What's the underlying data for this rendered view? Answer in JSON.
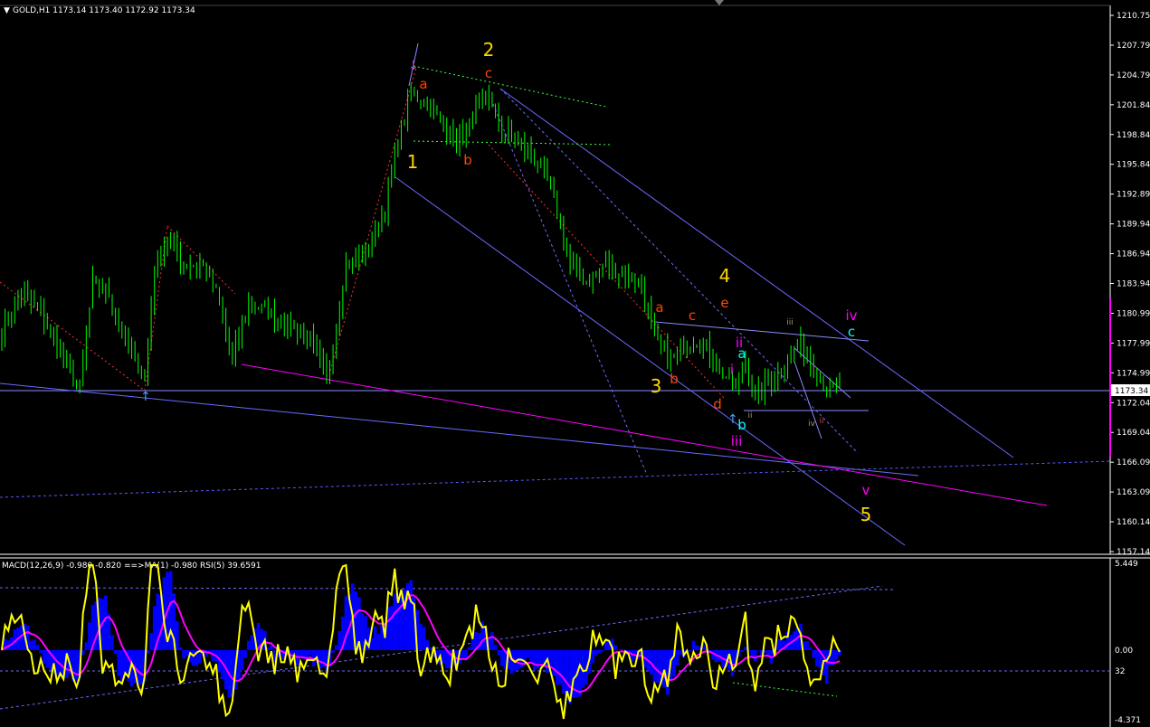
{
  "main_header": "GOLD,H1  1173.14 1173.40 1172.92 1173.34",
  "sub_header": "MACD(12,26,9) -0.980 -0.820  ==>MA(1) -0.980  RSI(5) 39.6591",
  "price_scale": [
    "1210.75",
    "1207.79",
    "1204.79",
    "1201.84",
    "1198.84",
    "1195.84",
    "1192.89",
    "1189.94",
    "1186.94",
    "1183.94",
    "1180.99",
    "1177.99",
    "1174.99",
    "1172.04",
    "1169.04",
    "1166.09",
    "1163.09",
    "1160.14",
    "1157.14"
  ],
  "current_price": "1173.34",
  "osc_scale": [
    "5.449",
    "0.00",
    "32",
    "-4.371"
  ],
  "colors": {
    "bg": "#000000",
    "candle": "#00ff00",
    "grid_line": "#6a6aff",
    "magenta": "#ff00ff",
    "yellow": "#ffff00",
    "pink": "#ff00ff",
    "hist": "#0000ff",
    "wave_main": "#ffd700",
    "wave_sub": "#ff4500",
    "wave_cyan": "#00ffff",
    "wave_mag": "#ff00ff"
  },
  "wave_labels": [
    {
      "text": "1",
      "color": "#ffd700",
      "size": "main"
    },
    {
      "text": "2",
      "color": "#ffd700",
      "size": "main"
    },
    {
      "text": "3",
      "color": "#ffd700",
      "size": "main"
    },
    {
      "text": "4",
      "color": "#ffd700",
      "size": "main"
    },
    {
      "text": "5",
      "color": "#ffd700",
      "size": "main"
    },
    {
      "text": "a",
      "color": "#ff4500",
      "size": "sub"
    },
    {
      "text": "b",
      "color": "#ff4500",
      "size": "sub"
    },
    {
      "text": "c",
      "color": "#ff4500",
      "size": "sub"
    },
    {
      "text": "a",
      "color": "#ff4500",
      "size": "sub"
    },
    {
      "text": "b",
      "color": "#ff4500",
      "size": "sub"
    },
    {
      "text": "c",
      "color": "#ff4500",
      "size": "sub"
    },
    {
      "text": "d",
      "color": "#ff4500",
      "size": "sub"
    },
    {
      "text": "e",
      "color": "#ff4500",
      "size": "sub"
    },
    {
      "text": "i",
      "color": "#ff00ff",
      "size": "sub"
    },
    {
      "text": "ii",
      "color": "#ff00ff",
      "size": "sub"
    },
    {
      "text": "iii",
      "color": "#ff00ff",
      "size": "sub"
    },
    {
      "text": "iv",
      "color": "#ff00ff",
      "size": "sub"
    },
    {
      "text": "v",
      "color": "#ff00ff",
      "size": "sub"
    },
    {
      "text": "a",
      "color": "#00ffff",
      "size": "sub"
    },
    {
      "text": "b",
      "color": "#00ffff",
      "size": "sub"
    },
    {
      "text": "c",
      "color": "#00ffff",
      "size": "sub"
    },
    {
      "text": "iii",
      "color": "#9a9a6a",
      "size": "tiny"
    },
    {
      "text": "ii",
      "color": "#9a9a6a",
      "size": "tiny"
    },
    {
      "text": "iv",
      "color": "#9a9a6a",
      "size": "tiny"
    },
    {
      "text": "i",
      "color": "#cc4444",
      "size": "tiny"
    },
    {
      "text": "ii",
      "color": "#cc4444",
      "size": "tiny"
    }
  ],
  "chart_data": {
    "type": "candlestick",
    "symbol": "GOLD",
    "timeframe": "H1",
    "ylim": [
      1156.0,
      1212.0
    ],
    "close_path": [
      {
        "bar": 0,
        "price": 1179.0
      },
      {
        "bar": 6,
        "price": 1183.0
      },
      {
        "bar": 12,
        "price": 1181.0
      },
      {
        "bar": 18,
        "price": 1177.0
      },
      {
        "bar": 24,
        "price": 1173.0
      },
      {
        "bar": 28,
        "price": 1184.0
      },
      {
        "bar": 33,
        "price": 1183.0
      },
      {
        "bar": 38,
        "price": 1178.0
      },
      {
        "bar": 44,
        "price": 1174.0
      },
      {
        "bar": 47,
        "price": 1186.0
      },
      {
        "bar": 51,
        "price": 1189.0
      },
      {
        "bar": 56,
        "price": 1186.0
      },
      {
        "bar": 62,
        "price": 1186.0
      },
      {
        "bar": 66,
        "price": 1183.0
      },
      {
        "bar": 71,
        "price": 1176.0
      },
      {
        "bar": 76,
        "price": 1182.0
      },
      {
        "bar": 82,
        "price": 1181.0
      },
      {
        "bar": 88,
        "price": 1180.0
      },
      {
        "bar": 95,
        "price": 1178.0
      },
      {
        "bar": 100,
        "price": 1174.0
      },
      {
        "bar": 106,
        "price": 1186.0
      },
      {
        "bar": 112,
        "price": 1187.0
      },
      {
        "bar": 118,
        "price": 1192.0
      },
      {
        "bar": 122,
        "price": 1199.0
      },
      {
        "bar": 126,
        "price": 1204.0
      },
      {
        "bar": 130,
        "price": 1203.0
      },
      {
        "bar": 135,
        "price": 1201.0
      },
      {
        "bar": 140,
        "price": 1199.0
      },
      {
        "bar": 145,
        "price": 1201.0
      },
      {
        "bar": 149,
        "price": 1204.0
      },
      {
        "bar": 154,
        "price": 1200.0
      },
      {
        "bar": 159,
        "price": 1199.0
      },
      {
        "bar": 164,
        "price": 1197.0
      },
      {
        "bar": 169,
        "price": 1194.0
      },
      {
        "bar": 175,
        "price": 1186.0
      },
      {
        "bar": 180,
        "price": 1184.0
      },
      {
        "bar": 186,
        "price": 1186.0
      },
      {
        "bar": 192,
        "price": 1185.0
      },
      {
        "bar": 197,
        "price": 1184.0
      },
      {
        "bar": 201,
        "price": 1178.0
      },
      {
        "bar": 206,
        "price": 1176.0
      },
      {
        "bar": 211,
        "price": 1178.0
      },
      {
        "bar": 216,
        "price": 1178.0
      },
      {
        "bar": 221,
        "price": 1175.0
      },
      {
        "bar": 226,
        "price": 1173.0
      },
      {
        "bar": 229,
        "price": 1176.0
      },
      {
        "bar": 232,
        "price": 1172.0
      },
      {
        "bar": 237,
        "price": 1174.0
      },
      {
        "bar": 242,
        "price": 1176.0
      },
      {
        "bar": 246,
        "price": 1178.0
      },
      {
        "bar": 250,
        "price": 1175.0
      },
      {
        "bar": 254,
        "price": 1173.0
      },
      {
        "bar": 258,
        "price": 1173.3
      }
    ],
    "indicators": {
      "macd": {
        "params": "12,26,9",
        "main": -0.98,
        "signal": -0.82,
        "range": [
          -4.371,
          5.449
        ]
      },
      "rsi": {
        "period": 5,
        "value": 39.6591
      }
    }
  }
}
